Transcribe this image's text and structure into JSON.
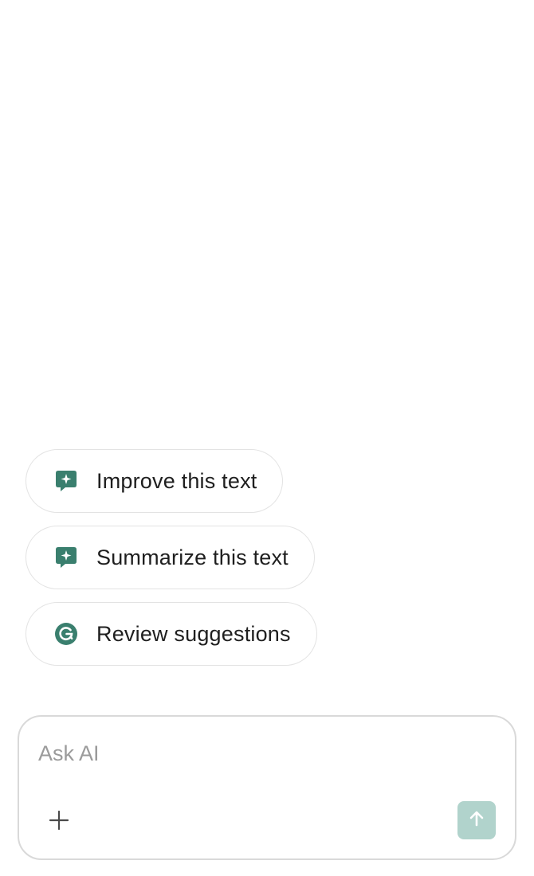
{
  "suggestions": [
    {
      "label": "Improve this text",
      "icon": "sparkle-chat-icon"
    },
    {
      "label": "Summarize this text",
      "icon": "sparkle-chat-icon"
    },
    {
      "label": "Review suggestions",
      "icon": "grammarly-logo-icon"
    }
  ],
  "composer": {
    "placeholder": "Ask AI",
    "value": "",
    "add_icon": "plus-icon",
    "send_icon": "arrow-up-icon"
  },
  "colors": {
    "accent": "#3a7f6e",
    "send_button_disabled": "#b1d3cc",
    "chip_border": "#e3e3e3",
    "text": "#1f1f1f",
    "placeholder": "#9b9b9b"
  }
}
